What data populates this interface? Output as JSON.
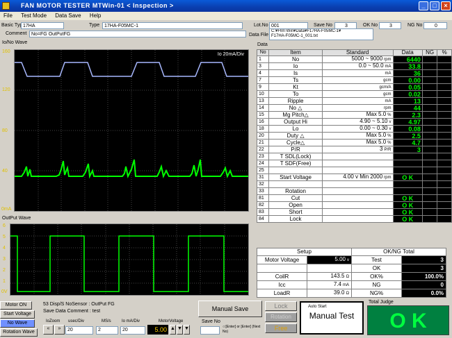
{
  "title": "FAN MOTOR TESTER  MTWin-01 < Inspection >",
  "menu": [
    "File",
    "Test Mode",
    "Data Save",
    "Help"
  ],
  "basic_type_label": "Basic Type",
  "basic_type": "17HA",
  "type_label": "Type",
  "type_value": "17HA-F05MC-1",
  "comment_label": "Comment",
  "comment": "No=FG OutPutFG",
  "lotno_label": "Lot.No",
  "lotno": "001",
  "saveno_label": "Save No",
  "saveno": "3",
  "okno_label": "OK No",
  "okno": "3",
  "ngno_label": "NG No",
  "ngno": "0",
  "datafile_label": "Data File",
  "datafile_line1": "C:¥FMTWin¥Data¥F17HA-F05MC-1¥",
  "datafile_line2": "F17HA-F05MC-1_001.txt",
  "io_wave_label": "Io/No Wave",
  "io_scale": "Io  20mA/Div",
  "io_yticks": [
    "160",
    "120",
    "80",
    "40",
    "0mA"
  ],
  "out_wave_label": "OutPut Wave",
  "out_yticks": [
    "6",
    "5",
    "4",
    "3",
    "2",
    "1",
    "0V"
  ],
  "data_label": "Data",
  "table_headers": [
    "No",
    "Item",
    "Standard",
    "Data",
    "NG",
    "%"
  ],
  "rows": [
    {
      "no": "1",
      "item": "No",
      "std": "5000 ~  9000",
      "unit": "rpm",
      "data": "6440"
    },
    {
      "no": "3",
      "item": "Io",
      "std": "0.0 ~  50.0",
      "unit": "mA",
      "data": "33.8"
    },
    {
      "no": "4",
      "item": "Is",
      "std": "",
      "unit": "mA",
      "data": "36"
    },
    {
      "no": "7",
      "item": "Ts",
      "std": "",
      "unit": "gcm",
      "data": "0.00"
    },
    {
      "no": "9",
      "item": "Kt",
      "std": "",
      "unit": "gcm/A",
      "data": "0.05"
    },
    {
      "no": "10",
      "item": "To",
      "std": "",
      "unit": "gcm",
      "data": "0.02"
    },
    {
      "no": "13",
      "item": "Ripple",
      "std": "",
      "unit": "mA",
      "data": "13"
    },
    {
      "no": "14",
      "item": "No △",
      "std": "",
      "unit": "rpm",
      "data": "44"
    },
    {
      "no": "15",
      "item": "Mg Pitch△",
      "std": "Max    5.0",
      "unit": "%",
      "data": "2.3"
    },
    {
      "no": "16",
      "item": "Output Hi",
      "std": "4.90 ~  5.10",
      "unit": "v",
      "data": "4.97"
    },
    {
      "no": "18",
      "item": "Lo",
      "std": "0.00 ~  0.30",
      "unit": "v",
      "data": "0.08"
    },
    {
      "no": "20",
      "item": "Duty △",
      "std": "Max    5.0",
      "unit": "%",
      "data": "2.5"
    },
    {
      "no": "21",
      "item": "Cycle△",
      "std": "Max    5.0",
      "unit": "%",
      "data": "4.7"
    },
    {
      "no": "22",
      "item": "P/R",
      "std": "3",
      "unit": "P/R",
      "data": "3"
    },
    {
      "no": "23",
      "item": "T SDL(Lock)",
      "std": "",
      "unit": "",
      "data": ""
    },
    {
      "no": "24",
      "item": "T SDF(Free)",
      "std": "",
      "unit": "",
      "data": ""
    },
    {
      "no": "25",
      "item": "",
      "std": "",
      "unit": "",
      "data": ""
    },
    {
      "no": "31",
      "item": "Start Voltage",
      "std": "4.00 v  Min 2000",
      "unit": "rpm",
      "data": "O K"
    },
    {
      "no": "32",
      "item": "",
      "std": "",
      "unit": "",
      "data": ""
    },
    {
      "no": "33",
      "item": "Rotation",
      "std": "",
      "unit": "",
      "data": ""
    },
    {
      "no": "81",
      "item": "Cut",
      "std": "",
      "unit": "",
      "data": "O K"
    },
    {
      "no": "82",
      "item": "Open",
      "std": "",
      "unit": "",
      "data": "O K"
    },
    {
      "no": "83",
      "item": "Short",
      "std": "",
      "unit": "",
      "data": "O K"
    },
    {
      "no": "84",
      "item": "Lock",
      "std": "",
      "unit": "",
      "data": "O K"
    }
  ],
  "setup_label": "Setup",
  "oknng_total_label": "OK/NG Total",
  "setup": [
    {
      "label": "Motor Voltage",
      "value": "5.00",
      "unit": "v"
    },
    {
      "label": "",
      "value": "",
      "unit": ""
    },
    {
      "label": "CoilR",
      "value": "143.5",
      "unit": "Ω"
    },
    {
      "label": "Icc",
      "value": "7.4",
      "unit": "mA"
    },
    {
      "label": "LoadR",
      "value": "39.0",
      "unit": "Ω"
    }
  ],
  "totals": [
    {
      "label": "Test",
      "value": "3"
    },
    {
      "label": "OK",
      "value": "3"
    },
    {
      "label": "OK%",
      "value": "100.0%"
    },
    {
      "label": "NG",
      "value": "0"
    },
    {
      "label": "NG%",
      "value": "0.0%"
    }
  ],
  "buttons": {
    "motor_on": "Motor ON",
    "start_voltage": "Start Voltage",
    "no_wave": "No Wave",
    "rotation_wave": "Rotation Wave",
    "manual_save": "Manual Save",
    "lock": "Lock",
    "rotation": "Rotation",
    "free": "Free",
    "auto_start": "Auto Start",
    "manual_test": "Manual Test"
  },
  "status_line1": "53 Disp/S  NoSensor : OutPut FG",
  "status_line2": "Save Data Comment : test",
  "iozoom_label": "IoZoom",
  "usec_label": "usec/Div",
  "usec_value": "20",
  "ms_label": "MS/s",
  "ms_value": "2",
  "iomadiv_label": "Io mA/Div",
  "iomadiv_value": "20",
  "motorvolt_label": "MotorVoltage",
  "motorvolt_value": "5.00",
  "saveno_bottom_label": "Save No",
  "save_hint": "○:[Enter] or [Enter] (Next No)",
  "total_judge_label": "Total Judge",
  "total_judge": "O K"
}
